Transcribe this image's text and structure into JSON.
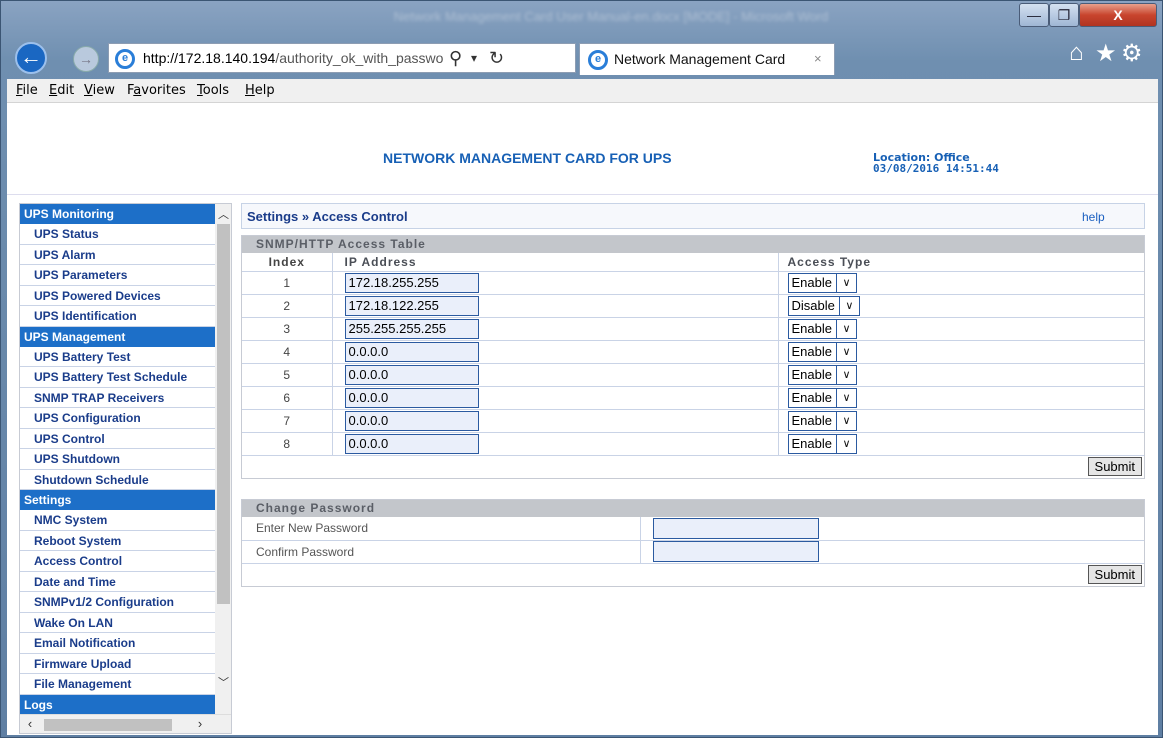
{
  "window": {
    "title": "Network Management Card User Manual-en.docx [MODE] - Microsoft Word",
    "minimize_glyph": "—",
    "maximize_glyph": "❐",
    "close_glyph": "X"
  },
  "browser": {
    "back_glyph": "←",
    "forward_glyph": "→",
    "url_host": "http://172.18.140.194",
    "url_path": "/authority_ok_with_password.",
    "search_glyph": "⚲",
    "drop_glyph": "▾",
    "refresh_glyph": "↻",
    "tab_title": "Network Management Card",
    "tab_close": "×",
    "icons": [
      "ie-logo-icon",
      "home-icon",
      "star-icon",
      "gear-icon"
    ],
    "home_glyph": "⌂",
    "star_glyph": "★",
    "gear_glyph": "⚙"
  },
  "menubar": [
    {
      "pre": "",
      "key": "F",
      "post": "ile"
    },
    {
      "pre": "",
      "key": "E",
      "post": "dit"
    },
    {
      "pre": "",
      "key": "V",
      "post": "iew"
    },
    {
      "pre": "F",
      "key": "a",
      "post": "vorites"
    },
    {
      "pre": "",
      "key": "T",
      "post": "ools"
    },
    {
      "pre": "",
      "key": "H",
      "post": "elp"
    }
  ],
  "header": {
    "title": "NETWORK MANAGEMENT CARD FOR UPS",
    "location": "Location: Office",
    "datetime": "03/08/2016 14:51:44"
  },
  "sidebar": {
    "groups": [
      {
        "label": "UPS Monitoring",
        "items": [
          "UPS Status",
          "UPS Alarm",
          "UPS Parameters",
          "UPS Powered Devices",
          "UPS Identification"
        ]
      },
      {
        "label": "UPS Management",
        "items": [
          "UPS Battery Test",
          "UPS Battery Test Schedule",
          "SNMP TRAP Receivers",
          "UPS Configuration",
          "UPS Control",
          "UPS Shutdown",
          "Shutdown Schedule"
        ]
      },
      {
        "label": "Settings",
        "items": [
          "NMC System",
          "Reboot System",
          "Access Control",
          "Date and Time",
          "SNMPv1/2 Configuration",
          "Wake On LAN",
          "Email Notification",
          "Firmware Upload",
          "File Management"
        ]
      },
      {
        "label": "Logs",
        "items": []
      }
    ],
    "scroll_up": "︿",
    "scroll_down": "﹀",
    "scroll_left": "‹",
    "scroll_right": "›"
  },
  "main": {
    "breadcrumb": "Settings » Access Control",
    "help": "help",
    "access_table": {
      "heading": "SNMP/HTTP Access Table",
      "columns": [
        "Index",
        "IP Address",
        "Access Type"
      ],
      "rows": [
        {
          "index": "1",
          "ip": "172.18.255.255",
          "access": "Enable"
        },
        {
          "index": "2",
          "ip": "172.18.122.255",
          "access": "Disable"
        },
        {
          "index": "3",
          "ip": "255.255.255.255",
          "access": "Enable"
        },
        {
          "index": "4",
          "ip": "0.0.0.0",
          "access": "Enable"
        },
        {
          "index": "5",
          "ip": "0.0.0.0",
          "access": "Enable"
        },
        {
          "index": "6",
          "ip": "0.0.0.0",
          "access": "Enable"
        },
        {
          "index": "7",
          "ip": "0.0.0.0",
          "access": "Enable"
        },
        {
          "index": "8",
          "ip": "0.0.0.0",
          "access": "Enable"
        }
      ],
      "submit": "Submit"
    },
    "password": {
      "heading": "Change Password",
      "new_label": "Enter New Password",
      "confirm_label": "Confirm Password",
      "submit": "Submit"
    }
  }
}
